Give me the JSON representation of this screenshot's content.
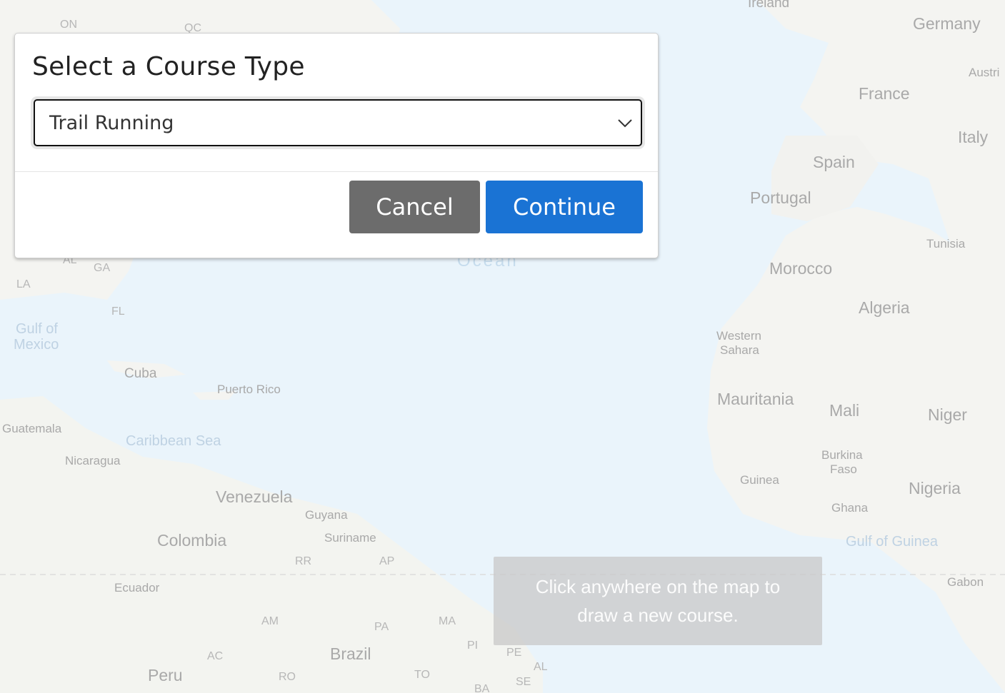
{
  "dialog": {
    "title": "Select a Course Type",
    "select_value": "Trail Running",
    "cancel_label": "Cancel",
    "continue_label": "Continue"
  },
  "hint": {
    "line1": "Click anywhere on the map to",
    "line2": "draw a new course."
  },
  "map_labels": {
    "ireland": "Ireland",
    "germany": "Germany",
    "austria": "Austri",
    "france": "France",
    "italy": "Italy",
    "spain": "Spain",
    "portugal": "Portugal",
    "tunisia": "Tunisia",
    "morocco": "Morocco",
    "algeria": "Algeria",
    "western_sahara_1": "Western",
    "western_sahara_2": "Sahara",
    "mauritania": "Mauritania",
    "mali": "Mali",
    "niger": "Niger",
    "burkina_1": "Burkina",
    "burkina_2": "Faso",
    "guinea": "Guinea",
    "nigeria": "Nigeria",
    "ghana": "Ghana",
    "gulf_guinea": "Gulf of Guinea",
    "gabon": "Gabon",
    "on": "ON",
    "qc": "QC",
    "ga": "GA",
    "al": "AL",
    "la": "LA",
    "fl": "FL",
    "gulf_mexico_1": "Gulf of",
    "gulf_mexico_2": "Mexico",
    "cuba": "Cuba",
    "puerto_rico": "Puerto Rico",
    "guatemala": "Guatemala",
    "caribbean": "Caribbean Sea",
    "nicaragua": "Nicaragua",
    "venezuela": "Venezuela",
    "guyana": "Guyana",
    "suriname": "Suriname",
    "colombia": "Colombia",
    "rr": "RR",
    "ap": "AP",
    "ecuador": "Ecuador",
    "am": "AM",
    "pa": "PA",
    "ma": "MA",
    "pi": "PI",
    "pe": "PE",
    "al2": "AL",
    "se": "SE",
    "ba": "BA",
    "to": "TO",
    "ro": "RO",
    "ac": "AC",
    "brazil": "Brazil",
    "peru": "Peru",
    "ocean": "Ocean"
  },
  "colors": {
    "water": "#eaf4fb",
    "land": "#f4f4f1",
    "continue": "#1a73d4",
    "cancel": "#6c6c6c"
  }
}
